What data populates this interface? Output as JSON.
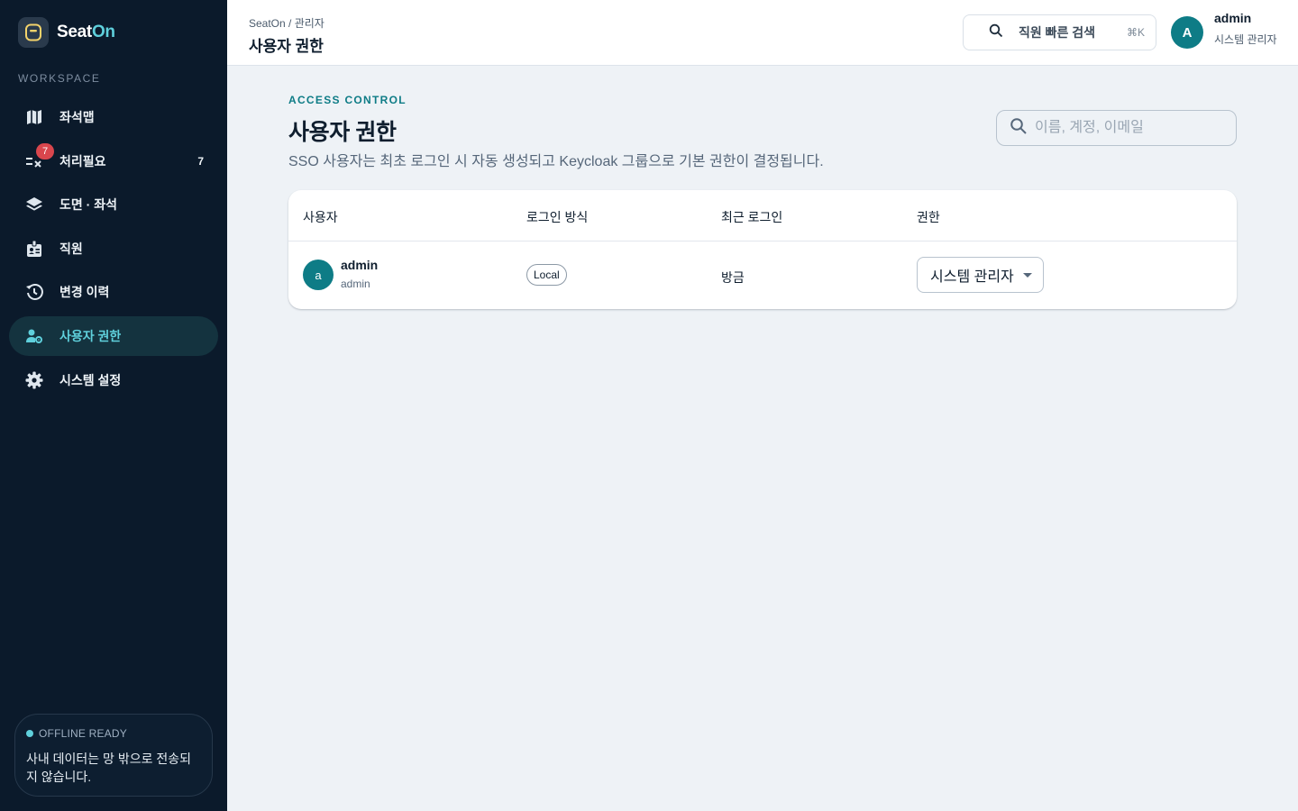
{
  "sidebar": {
    "brand": {
      "name_main": "Seat",
      "name_accent": "On"
    },
    "workspace_label": "WORKSPACE",
    "items": [
      {
        "label": "좌석맵",
        "icon": "map-icon"
      },
      {
        "label": "처리필요",
        "icon": "checklist-icon",
        "badge": "7",
        "count": "7"
      },
      {
        "label": "도면 · 좌석",
        "icon": "layers-icon"
      },
      {
        "label": "직원",
        "icon": "id-badge-icon"
      },
      {
        "label": "변경 이력",
        "icon": "history-icon"
      },
      {
        "label": "사용자 권한",
        "icon": "user-gear-icon",
        "active": true
      },
      {
        "label": "시스템 설정",
        "icon": "gear-icon"
      }
    ],
    "offline": {
      "title": "OFFLINE READY",
      "text": "사내 데이터는 망 밖으로 전송되지 않습니다."
    }
  },
  "header": {
    "breadcrumb": "SeatOn / 관리자",
    "title": "사용자 권한",
    "quick_search": {
      "label": "직원 빠른 검색",
      "shortcut": "⌘K"
    },
    "user": {
      "initial": "A",
      "name": "admin",
      "role": "시스템 관리자"
    }
  },
  "main": {
    "eyebrow": "ACCESS CONTROL",
    "title": "사용자 권한",
    "subtitle": "SSO 사용자는 최초 로그인 시 자동 생성되고 Keycloak 그룹으로 기본 권한이 결정됩니다.",
    "filter_placeholder": "이름, 계정, 이메일",
    "table": {
      "columns": [
        "사용자",
        "로그인 방식",
        "최근 로그인",
        "권한"
      ],
      "rows": [
        {
          "initial": "a",
          "name": "admin",
          "account": "admin",
          "login_method": "Local",
          "last_login": "방금",
          "role": "시스템 관리자"
        }
      ]
    }
  },
  "colors": {
    "sidebar_bg": "#0b1a2b",
    "accent": "#0e7c86",
    "accent_light": "#5fd0dc",
    "badge": "#d9464d"
  }
}
